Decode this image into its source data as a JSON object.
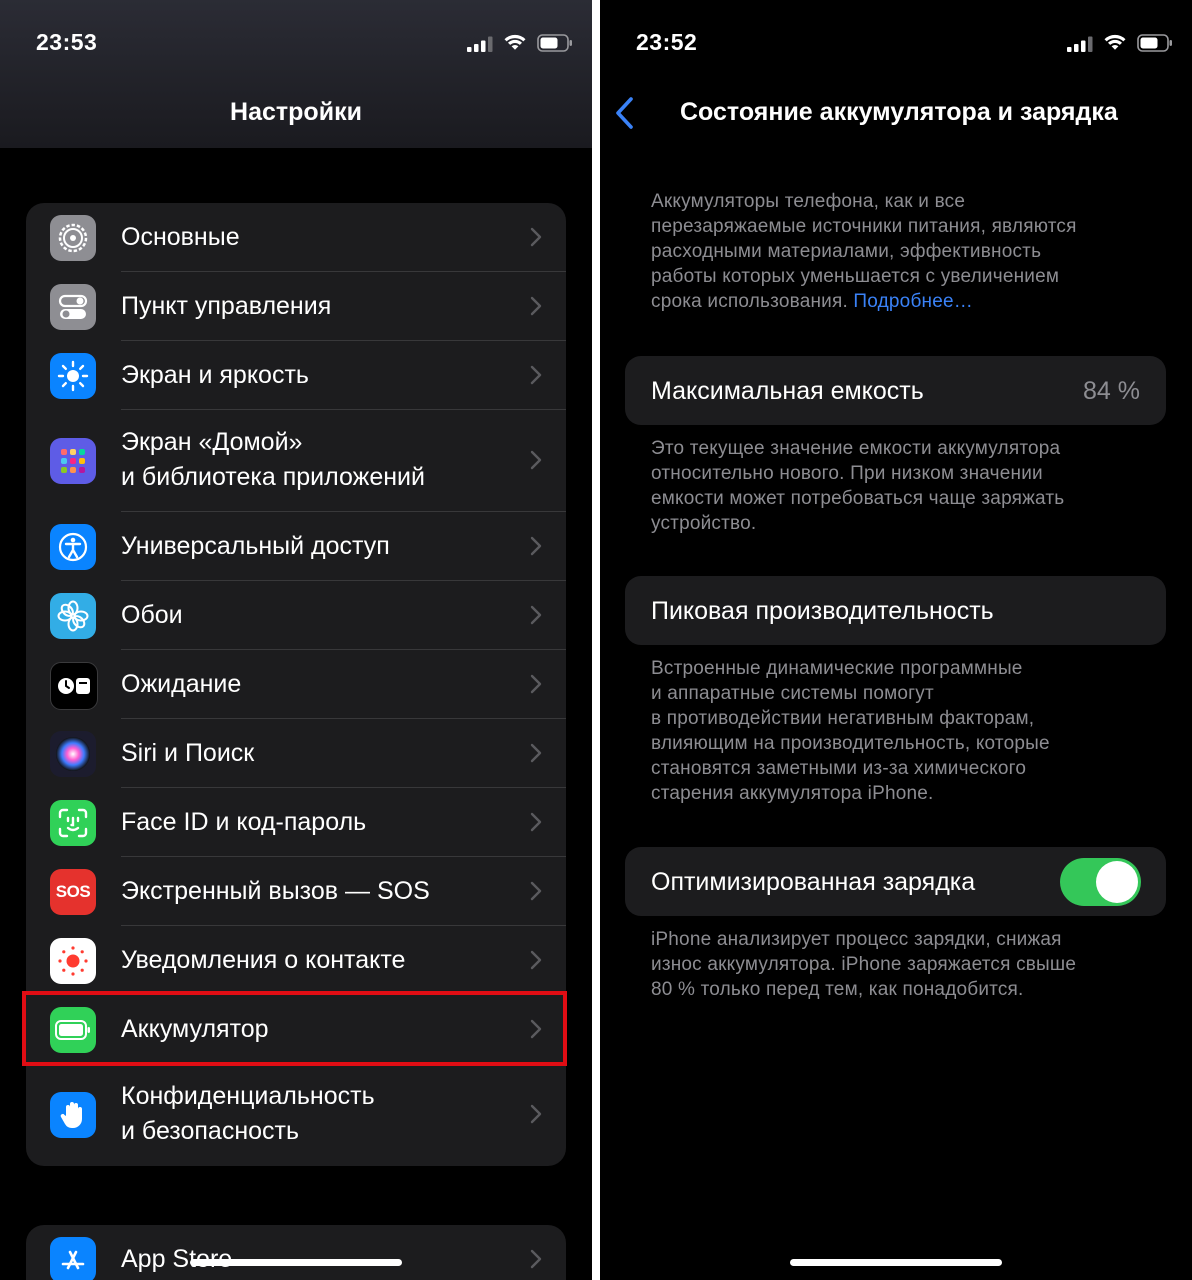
{
  "left": {
    "status_time": "23:53",
    "title": "Настройки",
    "group_main": [
      {
        "lines": [
          "Основные"
        ],
        "icon": "gear-icon",
        "color": "#8e8e93"
      },
      {
        "lines": [
          "Пункт управления"
        ],
        "icon": "toggles-icon",
        "color": "#8e8e93"
      },
      {
        "lines": [
          "Экран и яркость"
        ],
        "icon": "sun-icon",
        "color": "#0a84ff"
      },
      {
        "lines": [
          "Экран «Домой»",
          "и библиотека приложений"
        ],
        "icon": "app-grid-icon",
        "color": "#5e5ce6"
      },
      {
        "lines": [
          "Универсальный доступ"
        ],
        "icon": "accessibility-icon",
        "color": "#0a84ff"
      },
      {
        "lines": [
          "Обои"
        ],
        "icon": "flower-icon",
        "color": "#32ade6"
      },
      {
        "lines": [
          "Ожидание"
        ],
        "icon": "standby-icon",
        "color": "#000000"
      },
      {
        "lines": [
          "Siri и Поиск"
        ],
        "icon": "siri-icon",
        "color": "#1c1c2e"
      },
      {
        "lines": [
          "Face ID и код-пароль"
        ],
        "icon": "face-id-icon",
        "color": "#30d158"
      },
      {
        "lines": [
          "Экстренный вызов — SOS"
        ],
        "icon": "sos-icon",
        "color": "#e5322d",
        "icon_text": "SOS"
      },
      {
        "lines": [
          "Уведомления о контакте"
        ],
        "icon": "exposure-icon",
        "color": "#ffffff"
      },
      {
        "lines": [
          "Аккумулятор"
        ],
        "icon": "battery-icon",
        "color": "#30d158"
      },
      {
        "lines": [
          "Конфиденциальность",
          "и безопасность"
        ],
        "icon": "hand-icon",
        "color": "#0a84ff"
      }
    ],
    "group_store": [
      {
        "lines": [
          "App Store"
        ],
        "icon": "app-store-icon",
        "color": "#0a84ff"
      }
    ],
    "highlight_color": "#e10d14"
  },
  "right": {
    "status_time": "23:52",
    "title": "Состояние аккумулятора и зарядка",
    "intro_lines": [
      "Аккумуляторы телефона, как и все",
      "перезаряжаемые источники питания, являются",
      "расходными материалами, эффективность",
      "работы которых уменьшается с увеличением"
    ],
    "intro_last": "срока использования.",
    "intro_link": "Подробнее…",
    "max_capacity": {
      "label": "Максимальная емкость",
      "value": "84 %"
    },
    "capacity_note": [
      "Это текущее значение емкости аккумулятора",
      "относительно нового. При низком значении",
      "емкости может потребоваться чаще заряжать",
      "устройство."
    ],
    "peak_performance": {
      "label": "Пиковая производительность"
    },
    "peak_note": [
      "Встроенные динамические программные",
      "и аппаратные системы помогут",
      "в противодействии негативным факторам,",
      "влияющим на производительность, которые",
      "становятся заметными из-за химического",
      "старения аккумулятора iPhone."
    ],
    "optimized_charging": {
      "label": "Оптимизированная зарядка",
      "on": true
    },
    "charging_note": [
      "iPhone анализирует процесс зарядки, снижая",
      "износ аккумулятора. iPhone заряжается свыше",
      "80 % только перед тем, как понадобится."
    ],
    "accent_color": "#3a82f7",
    "toggle_color": "#34c759"
  }
}
